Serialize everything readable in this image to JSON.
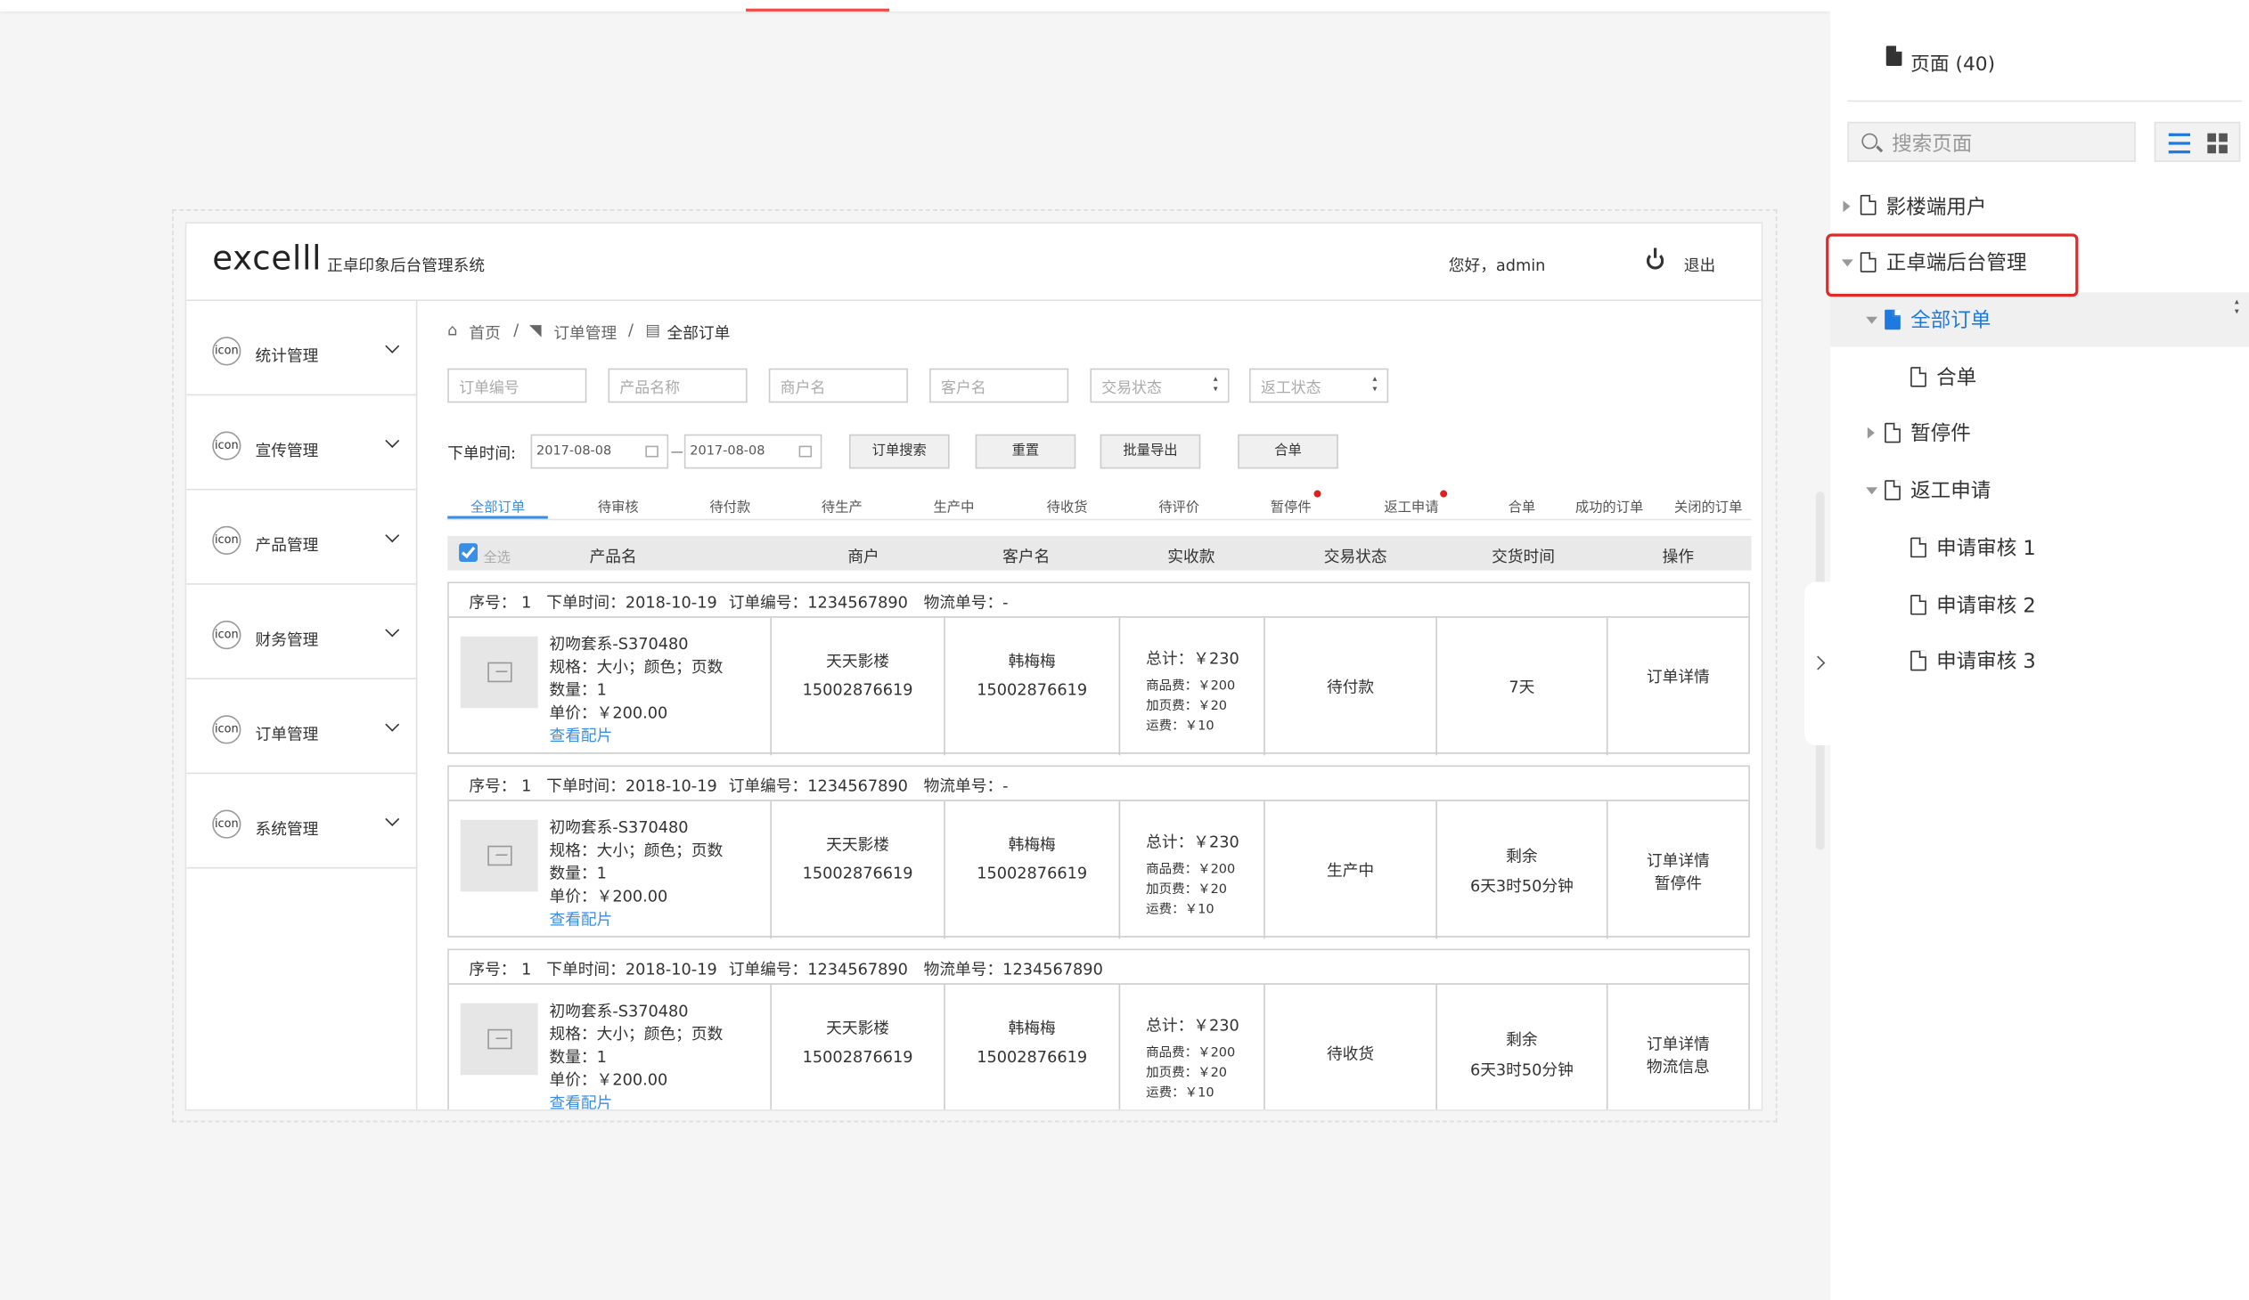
{
  "app": {
    "logo": "excelll",
    "system_title": "正卓印象后台管理系统",
    "greeting": "您好，admin",
    "logout": "退出"
  },
  "sidebar": {
    "icon_text": "icon",
    "items": [
      {
        "label": "统计管理"
      },
      {
        "label": "宣传管理"
      },
      {
        "label": "产品管理"
      },
      {
        "label": "财务管理"
      },
      {
        "label": "订单管理"
      },
      {
        "label": "系统管理"
      }
    ]
  },
  "breadcrumb": {
    "home": "首页",
    "sep": "/",
    "level1": "订单管理",
    "level2": "全部订单"
  },
  "filters": {
    "order_no": "订单编号",
    "product_name": "产品名称",
    "merchant_name": "商户名",
    "customer_name": "客户名",
    "trade_status": "交易状态",
    "rework_status": "返工状态",
    "date_label": "下单时间:",
    "date_from": "2017-08-08",
    "date_to": "2017-08-08"
  },
  "buttons": {
    "search": "订单搜索",
    "reset": "重置",
    "export": "批量导出",
    "merge": "合单"
  },
  "tabs": [
    "全部订单",
    "待审核",
    "待付款",
    "待生产",
    "生产中",
    "待收货",
    "待评价",
    "暂停件",
    "返工申请",
    "合单",
    "成功的订单",
    "关闭的订单"
  ],
  "table": {
    "select_all": "全选",
    "columns": [
      "产品名",
      "商户",
      "客户名",
      "实收款",
      "交易状态",
      "交货时间",
      "操作"
    ]
  },
  "orders": [
    {
      "seq": "序号：  1",
      "order_time": "下单时间：2018-10-19",
      "order_no": "订单编号：1234567890",
      "logistics_no": "物流单号：-",
      "product": {
        "name": "初吻套系-S370480",
        "spec": "规格：大小；颜色；页数",
        "qty": "数量：1",
        "price": "单价：￥200.00",
        "link": "查看配片"
      },
      "merchant": "天天影楼",
      "merchant_phone": "15002876619",
      "customer": "韩梅梅",
      "customer_phone": "15002876619",
      "amount": {
        "total": "总计：￥230",
        "goods": "商品费：￥200",
        "page": "加页费：￥20",
        "shipping": "运费：￥10"
      },
      "status": "待付款",
      "delivery_line1": "7天",
      "delivery_line2": "",
      "action1": "订单详情",
      "action2": ""
    },
    {
      "seq": "序号：  1",
      "order_time": "下单时间：2018-10-19",
      "order_no": "订单编号：1234567890",
      "logistics_no": "物流单号：-",
      "product": {
        "name": "初吻套系-S370480",
        "spec": "规格：大小；颜色；页数",
        "qty": "数量：1",
        "price": "单价：￥200.00",
        "link": "查看配片"
      },
      "merchant": "天天影楼",
      "merchant_phone": "15002876619",
      "customer": "韩梅梅",
      "customer_phone": "15002876619",
      "amount": {
        "total": "总计：￥230",
        "goods": "商品费：￥200",
        "page": "加页费：￥20",
        "shipping": "运费：￥10"
      },
      "status": "生产中",
      "delivery_line1": "剩余",
      "delivery_line2": "6天3时50分钟",
      "action1": "订单详情",
      "action2": "暂停件"
    },
    {
      "seq": "序号：  1",
      "order_time": "下单时间：2018-10-19",
      "order_no": "订单编号：1234567890",
      "logistics_no": "物流单号：1234567890",
      "product": {
        "name": "初吻套系-S370480",
        "spec": "规格：大小；颜色；页数",
        "qty": "数量：1",
        "price": "单价：￥200.00",
        "link": "查看配片"
      },
      "merchant": "天天影楼",
      "merchant_phone": "15002876619",
      "customer": "韩梅梅",
      "customer_phone": "15002876619",
      "amount": {
        "total": "总计：￥230",
        "goods": "商品费：￥200",
        "page": "加页费：￥20",
        "shipping": "运费：￥10"
      },
      "status": "待收货",
      "delivery_line1": "剩余",
      "delivery_line2": "6天3时50分钟",
      "action1": "订单详情",
      "action2": "物流信息"
    }
  ],
  "pages_panel": {
    "title": "页面 (40)",
    "search_placeholder": "搜索页面",
    "tree": [
      {
        "label": "影楼端用户",
        "state": "collapsed"
      },
      {
        "label": "正卓端后台管理",
        "state": "expanded",
        "highlighted": true
      },
      {
        "label": "全部订单",
        "state": "expanded",
        "selected": true
      },
      {
        "label": "合单",
        "state": "leaf"
      },
      {
        "label": "暂停件",
        "state": "collapsed"
      },
      {
        "label": "返工申请",
        "state": "expanded"
      },
      {
        "label": "申请审核 1",
        "state": "leaf"
      },
      {
        "label": "申请审核 2",
        "state": "leaf"
      },
      {
        "label": "申请审核 3",
        "state": "leaf"
      }
    ]
  },
  "colors": {
    "accent": "#3a8ee6",
    "panel_accent": "#1f7ae0",
    "highlight_box": "#e02929",
    "badge_dot": "#e02020",
    "top_line": "#f04a47"
  }
}
